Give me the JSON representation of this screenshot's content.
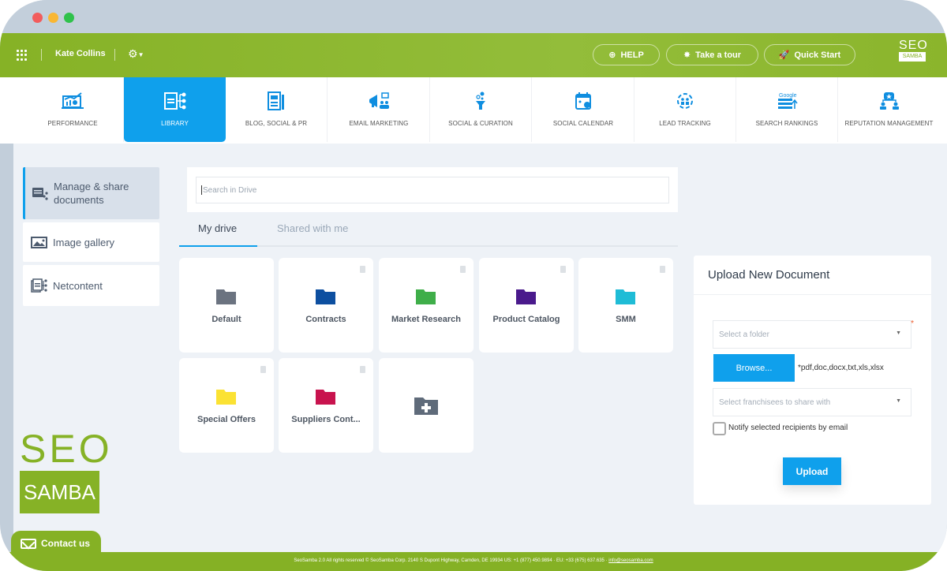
{
  "window": {
    "controls": [
      "close",
      "minimize",
      "maximize"
    ]
  },
  "topbar": {
    "apps_icon": "grid-icon",
    "user_name": "Kate Collins",
    "settings_icon": "gear-icon",
    "buttons": [
      {
        "label": "HELP",
        "icon": "lifebuoy-icon"
      },
      {
        "label": "Take a tour",
        "icon": "sparkle-icon"
      },
      {
        "label": "Quick Start",
        "icon": "rocket-icon"
      }
    ],
    "logo": {
      "top": "SEO",
      "bottom": "SAMBA"
    }
  },
  "modules": [
    {
      "label": "PERFORMANCE",
      "icon": "chart-icon",
      "active": false
    },
    {
      "label": "LIBRARY",
      "icon": "library-icon",
      "active": true
    },
    {
      "label": "BLOG, SOCIAL & PR",
      "icon": "blog-icon",
      "active": false
    },
    {
      "label": "EMAIL MARKETING",
      "icon": "megaphone-icon",
      "active": false
    },
    {
      "label": "SOCIAL & CURATION",
      "icon": "funnel-icon",
      "active": false
    },
    {
      "label": "SOCIAL CALENDAR",
      "icon": "calendar-icon",
      "active": false
    },
    {
      "label": "LEAD TRACKING",
      "icon": "target-icon",
      "active": false
    },
    {
      "label": "SEARCH RANKINGS",
      "icon": "google-rank-icon",
      "active": false
    },
    {
      "label": "REPUTATION MANAGEMENT",
      "icon": "reputation-icon",
      "active": false
    }
  ],
  "sidebar": {
    "items": [
      {
        "label": "Manage & share documents",
        "icon": "document-share-icon",
        "active": true
      },
      {
        "label": "Image gallery",
        "icon": "image-icon",
        "active": false
      },
      {
        "label": "Netcontent",
        "icon": "netcontent-icon",
        "active": false
      }
    ]
  },
  "drive": {
    "search_placeholder": "Search in Drive",
    "tabs": [
      {
        "label": "My drive",
        "active": true
      },
      {
        "label": "Shared with me",
        "active": false
      }
    ],
    "folders": [
      {
        "name": "Default",
        "color": "#6b7380",
        "deletable": false
      },
      {
        "name": "Contracts",
        "color": "#0d4fa0",
        "deletable": true
      },
      {
        "name": "Market Research",
        "color": "#3fae49",
        "deletable": true
      },
      {
        "name": "Product Catalog",
        "color": "#4a1a8c",
        "deletable": true
      },
      {
        "name": "SMM",
        "color": "#1fbcd6",
        "deletable": true
      },
      {
        "name": "Special Offers",
        "color": "#fbe233",
        "deletable": true
      },
      {
        "name": "Suppliers Cont...",
        "color": "#c8134e",
        "deletable": true
      }
    ],
    "add_folder_icon": "add-folder-icon"
  },
  "upload": {
    "title": "Upload New Document",
    "folder_placeholder": "Select a folder",
    "required_mark": "*",
    "browse_label": "Browse...",
    "extensions": "*pdf,doc,docx,txt,xls,xlsx",
    "franchisees_placeholder": "Select franchisees to share with",
    "notify_label": "Notify selected recipients by email",
    "notify_checked": false,
    "upload_label": "Upload"
  },
  "branding": {
    "top": "SEO",
    "bottom": "SAMBA"
  },
  "contact": {
    "label": "Contact us"
  },
  "footer": {
    "text": "SeoSamba 2.0  All rights reserved © SeoSamba Corp. 2140 S Dupont Highway, Camden, DE 19934 US: +1 (877) 450.9894 · EU: +33 (675) 637.635 · ",
    "email": "info@seosamba.com"
  },
  "colors": {
    "brand_green": "#86b226",
    "accent_blue": "#0fa0ec",
    "background": "#eef2f7"
  }
}
